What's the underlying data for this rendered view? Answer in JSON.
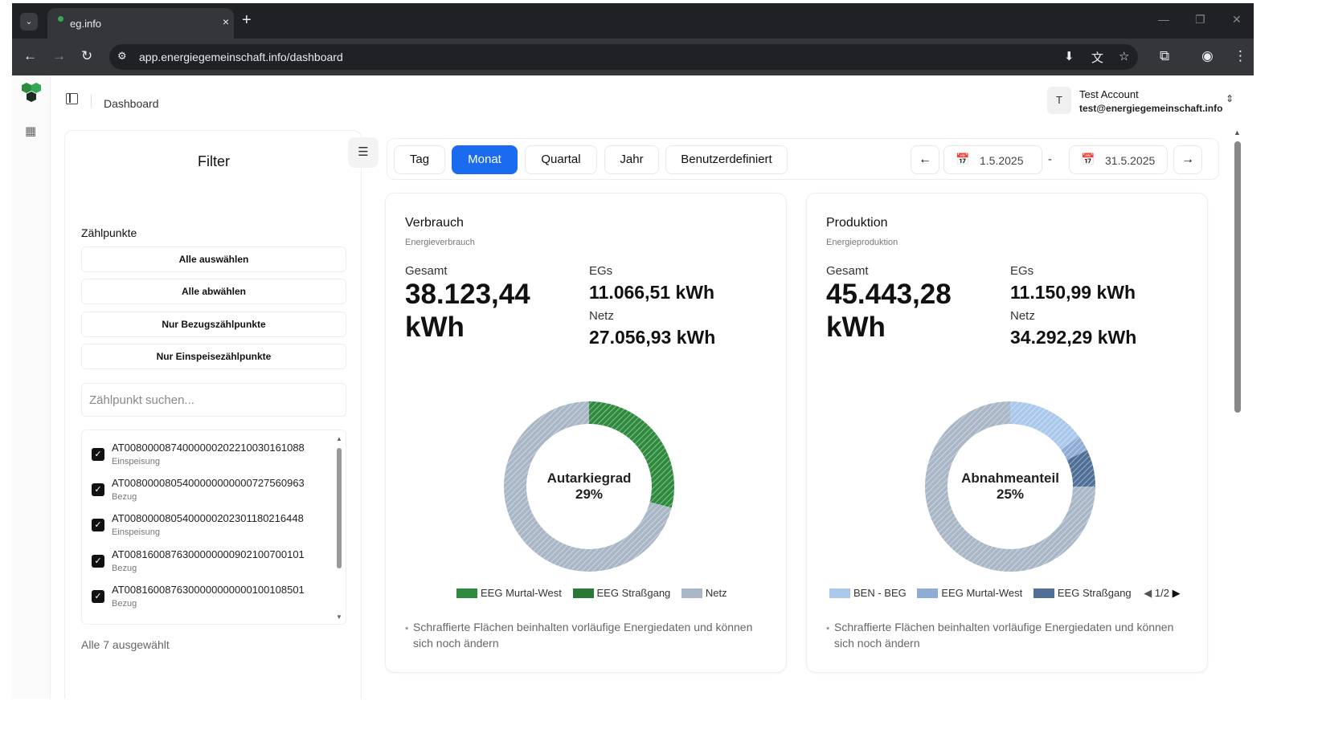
{
  "browser": {
    "tab_title": "eg.info",
    "tab_close": "×",
    "new_tab": "+",
    "url": "app.energiegemeinschaft.info/dashboard"
  },
  "header": {
    "title": "Dashboard",
    "account": {
      "initial": "T",
      "name": "Test Account",
      "email": "test@energiegemeinschaft.info"
    }
  },
  "filter": {
    "title": "Filter",
    "section_label": "Zählpunkte",
    "buttons": [
      "Alle auswählen",
      "Alle abwählen",
      "Nur Bezugszählpunkte",
      "Nur Einspeisezählpunkte"
    ],
    "search_placeholder": "Zählpunkt suchen...",
    "items": [
      {
        "id": "AT0080000874000000202210030161088",
        "type": "Einspeisung",
        "checked": true
      },
      {
        "id": "AT0080000805400000000000727560963",
        "type": "Bezug",
        "checked": true
      },
      {
        "id": "AT0080000805400000202301180216448",
        "type": "Einspeisung",
        "checked": true
      },
      {
        "id": "AT0081600876300000000902100700101",
        "type": "Bezug",
        "checked": true
      },
      {
        "id": "AT0081600876300000000000100108501",
        "type": "Bezug",
        "checked": true
      }
    ],
    "selection_summary": "Alle 7 ausgewählt"
  },
  "toolbar": {
    "periods": [
      "Tag",
      "Monat",
      "Quartal",
      "Jahr",
      "Benutzerdefiniert"
    ],
    "active_period": "Monat",
    "date_from": "1.5.2025",
    "date_to": "31.5.2025",
    "date_separator": "-"
  },
  "cards": {
    "verbrauch": {
      "title": "Verbrauch",
      "subtitle": "Energieverbrauch",
      "total_label": "Gesamt",
      "total_value": "38.123,44 kWh",
      "egs_label": "EGs",
      "egs_value": "11.066,51 kWh",
      "netz_label": "Netz",
      "netz_value": "27.056,93 kWh",
      "donut_label": "Autarkiegrad",
      "donut_value": "29%",
      "legend": [
        "EEG Murtal-West",
        "EEG Straßgang",
        "Netz"
      ],
      "note": "Schraffierte Flächen beinhalten vorläufige Energiedaten und können sich noch ändern"
    },
    "produktion": {
      "title": "Produktion",
      "subtitle": "Energieproduktion",
      "total_label": "Gesamt",
      "total_value": "45.443,28 kWh",
      "egs_label": "EGs",
      "egs_value": "11.150,99 kWh",
      "netz_label": "Netz",
      "netz_value": "34.292,29 kWh",
      "donut_label": "Abnahmeanteil",
      "donut_value": "25%",
      "legend": [
        "BEN - BEG",
        "EEG Murtal-West",
        "EEG Straßgang"
      ],
      "legend_page": "1/2",
      "note": "Schraffierte Flächen beinhalten vorläufige Energiedaten und können sich noch ändern"
    }
  },
  "chart_data": [
    {
      "type": "pie",
      "categories": [
        "EEG Murtal-West",
        "EEG Straßgang",
        "Netz"
      ],
      "values": [
        0,
        29,
        71
      ],
      "colors": [
        "#2e8b3e",
        "#2e8b3e",
        "#a8b6c6"
      ]
    },
    {
      "type": "pie",
      "categories": [
        "BEN - BEG",
        "EEG Murtal-West",
        "EEG Straßgang",
        "Netz"
      ],
      "values": [
        15,
        3,
        7,
        75
      ],
      "colors": [
        "#a9c8ec",
        "#8eacd4",
        "#4f6f96",
        "#a8b6c6"
      ]
    }
  ],
  "colors": {
    "accent": "#1a6bf0",
    "green": "#2e8b3e",
    "grey": "#a8b6c6"
  }
}
